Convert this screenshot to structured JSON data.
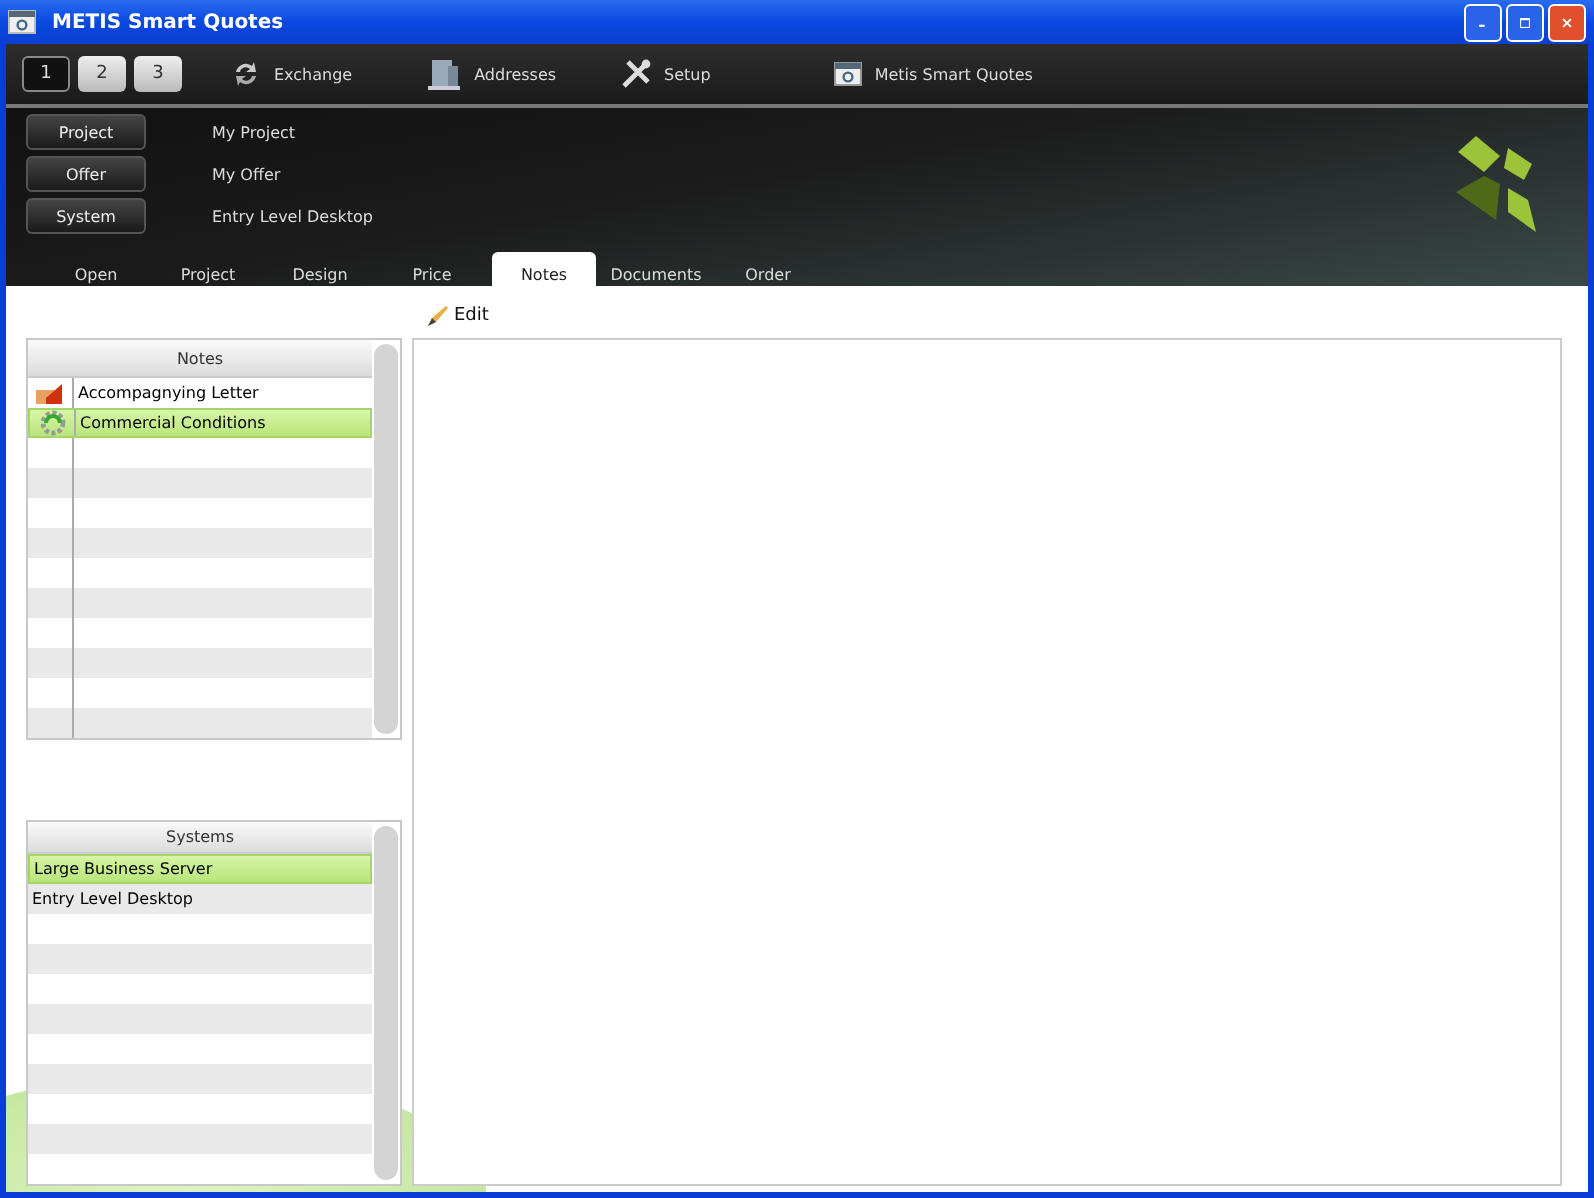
{
  "window": {
    "title": "METIS Smart Quotes"
  },
  "page_buttons": [
    {
      "label": "1",
      "selected": true
    },
    {
      "label": "2",
      "selected": false
    },
    {
      "label": "3",
      "selected": false
    }
  ],
  "toolbar": [
    {
      "label": "Exchange",
      "kind": "exchange"
    },
    {
      "label": "Addresses",
      "kind": "addresses"
    },
    {
      "label": "Setup",
      "kind": "setup"
    },
    {
      "label": "Metis Smart Quotes",
      "kind": "app"
    }
  ],
  "context": [
    {
      "button": "Project",
      "value": "My Project"
    },
    {
      "button": "Offer",
      "value": "My Offer"
    },
    {
      "button": "System",
      "value": "Entry Level Desktop"
    }
  ],
  "tabs": [
    {
      "label": "Open",
      "selected": false
    },
    {
      "label": "Project",
      "selected": false
    },
    {
      "label": "Design",
      "selected": false
    },
    {
      "label": "Price",
      "selected": false
    },
    {
      "label": "Notes",
      "selected": true
    },
    {
      "label": "Documents",
      "selected": false
    },
    {
      "label": "Order",
      "selected": false
    }
  ],
  "edit_button": "Edit",
  "notes": {
    "title": "Notes",
    "items": [
      {
        "label": "Accompagnying Letter",
        "kind": "letter",
        "selected": false
      },
      {
        "label": "Commercial Conditions",
        "kind": "conditions",
        "selected": true
      }
    ]
  },
  "systems": {
    "title": "Systems",
    "items": [
      {
        "label": "Large Business Server",
        "selected": true
      },
      {
        "label": "Entry Level Desktop",
        "selected": false
      }
    ]
  }
}
